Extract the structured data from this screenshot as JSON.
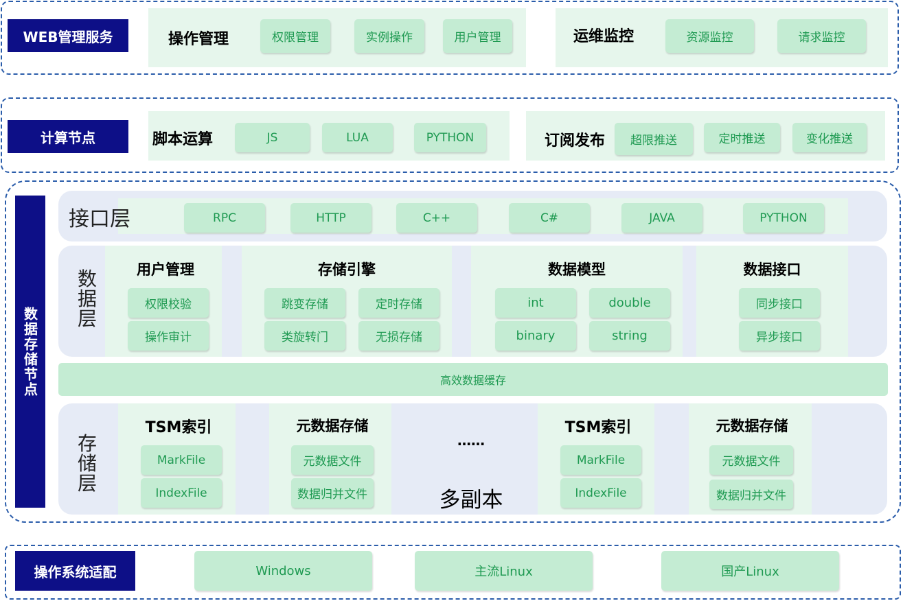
{
  "web": {
    "label": "WEB管理服务",
    "ops": {
      "title": "操作管理",
      "items": [
        "权限管理",
        "实例操作",
        "用户管理"
      ]
    },
    "monitor": {
      "title": "运维监控",
      "items": [
        "资源监控",
        "请求监控"
      ]
    }
  },
  "compute": {
    "label": "计算节点",
    "script": {
      "title": "脚本运算",
      "items": [
        "JS",
        "LUA",
        "PYTHON"
      ]
    },
    "pubsub": {
      "title": "订阅发布",
      "items": [
        "超限推送",
        "定时推送",
        "变化推送"
      ]
    }
  },
  "storage_node": {
    "label": "数据存储节点",
    "interface_layer": {
      "title": "接口层",
      "items": [
        "RPC",
        "HTTP",
        "C++",
        "C#",
        "JAVA",
        "PYTHON"
      ]
    },
    "data_layer": {
      "title": "数据层",
      "user_mgmt": {
        "title": "用户管理",
        "items": [
          "权限校验",
          "操作审计"
        ]
      },
      "engine": {
        "title": "存储引擎",
        "items": [
          "跳变存储",
          "定时存储",
          "类旋转门",
          "无损存储"
        ]
      },
      "model": {
        "title": "数据模型",
        "items": [
          "int",
          "double",
          "binary",
          "string"
        ]
      },
      "data_if": {
        "title": "数据接口",
        "items": [
          "同步接口",
          "异步接口"
        ]
      }
    },
    "cache": "高效数据缓存",
    "storage_layer": {
      "title": "存储层",
      "tsm1": {
        "title": "TSM索引",
        "items": [
          "MarkFile",
          "IndexFile"
        ]
      },
      "meta1": {
        "title": "元数据存储",
        "items": [
          "元数据文件",
          "数据归并文件"
        ]
      },
      "ellipsis": "……",
      "replica": "多副本",
      "tsm2": {
        "title": "TSM索引",
        "items": [
          "MarkFile",
          "IndexFile"
        ]
      },
      "meta2": {
        "title": "元数据存储",
        "items": [
          "元数据文件",
          "数据归并文件"
        ]
      }
    }
  },
  "os": {
    "label": "操作系统适配",
    "items": [
      "Windows",
      "主流Linux",
      "国产Linux"
    ]
  },
  "colors": {
    "navy": "#0d0f87",
    "dash": "#2a5caa",
    "chip_bg": "#c4ecd3",
    "chip_text": "#1f9a52",
    "panel": "#e6f6ec",
    "layer_bg": "#e6ebf6"
  }
}
